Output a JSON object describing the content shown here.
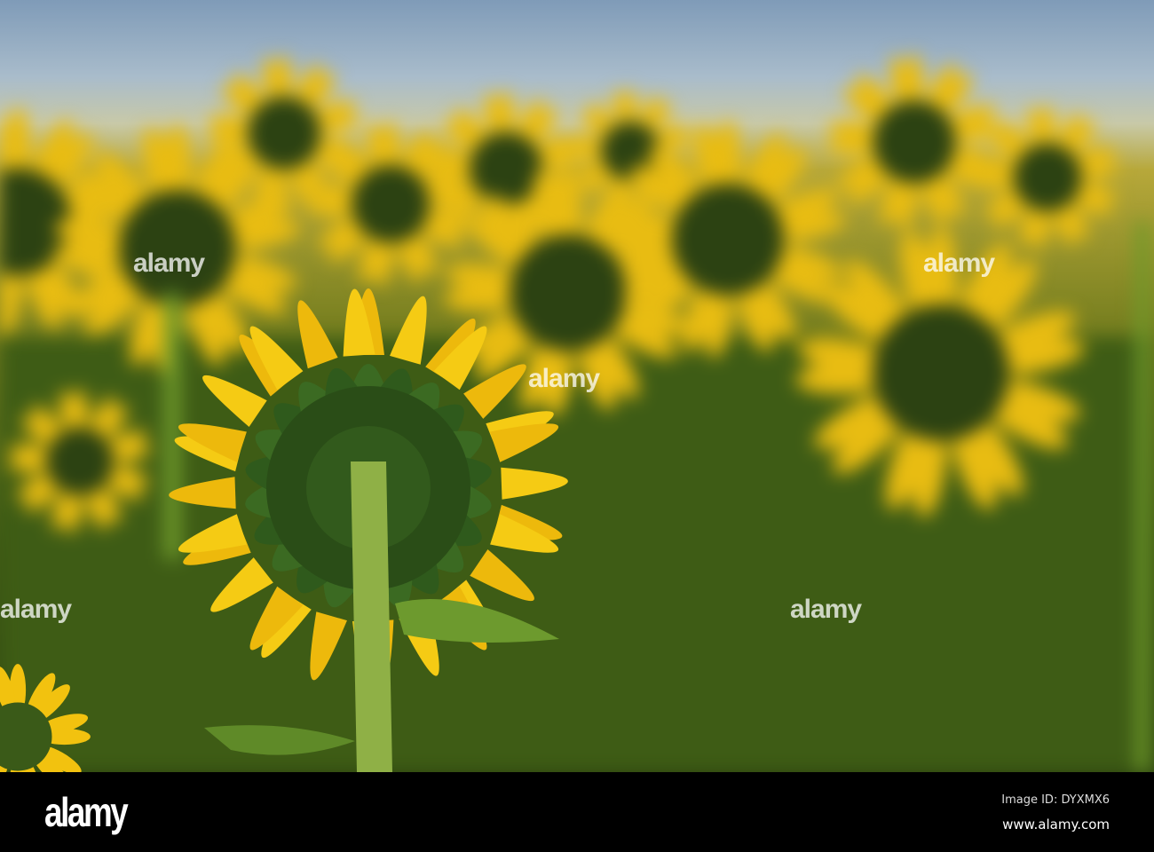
{
  "photo": {
    "subject": "sunflower-field",
    "watermark": "alamy"
  },
  "footer": {
    "logo": "alamy",
    "image_id": "Image ID: DYXMX6",
    "website": "www.alamy.com"
  },
  "colors": {
    "petal": "#f2c20f",
    "sepal": "#2f5418",
    "sky": "#9fb4c8",
    "foliage": "#4a6a18"
  }
}
